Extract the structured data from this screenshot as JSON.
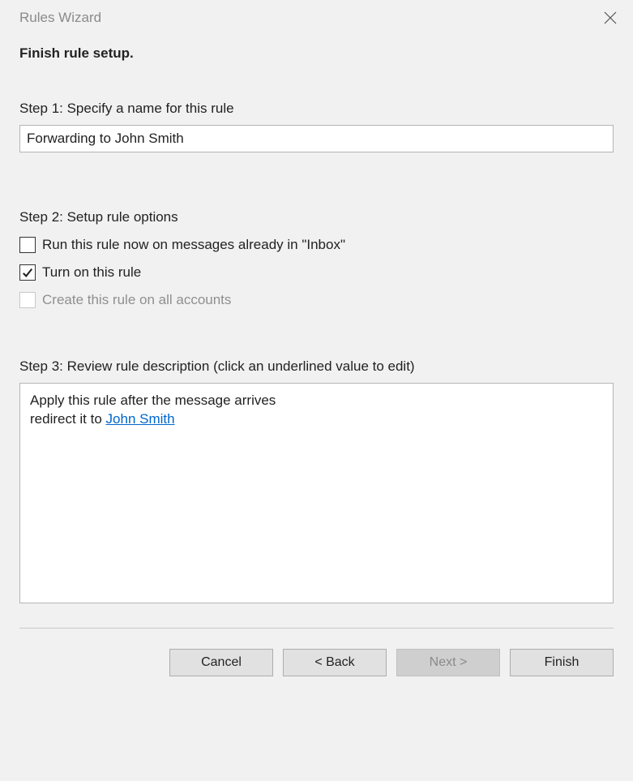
{
  "window": {
    "title": "Rules Wizard"
  },
  "heading": "Finish rule setup.",
  "step1": {
    "label": "Step 1: Specify a name for this rule",
    "value": "Forwarding to John Smith"
  },
  "step2": {
    "label": "Step 2: Setup rule options",
    "options": {
      "run_now": {
        "label": "Run this rule now on messages already in \"Inbox\"",
        "checked": false,
        "enabled": true
      },
      "turn_on": {
        "label": "Turn on this rule",
        "checked": true,
        "enabled": true
      },
      "all_accounts": {
        "label": "Create this rule on all accounts",
        "checked": false,
        "enabled": false
      }
    }
  },
  "step3": {
    "label": "Step 3: Review rule description (click an underlined value to edit)",
    "line1": "Apply this rule after the message arrives",
    "line2_prefix": "redirect it to ",
    "line2_link": "John Smith"
  },
  "buttons": {
    "cancel": "Cancel",
    "back": "< Back",
    "next": "Next >",
    "finish": "Finish"
  }
}
